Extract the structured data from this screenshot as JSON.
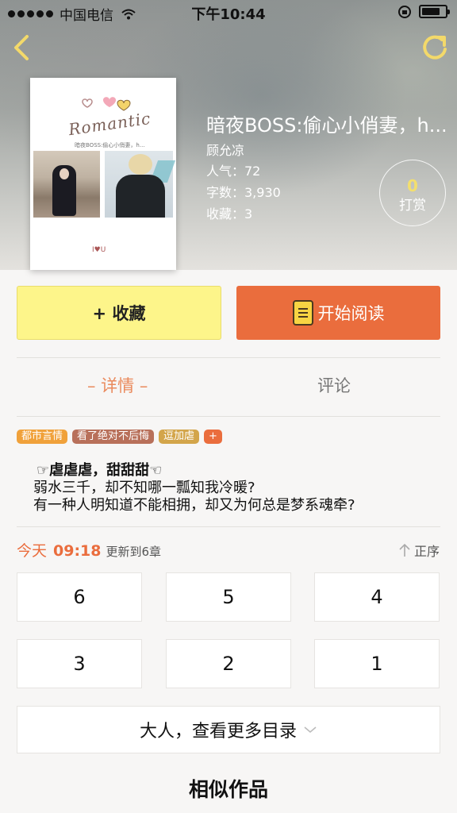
{
  "status_bar": {
    "carrier": "中国电信",
    "time": "下午10:44"
  },
  "book": {
    "title": "暗夜BOSS:偷心小俏妻，h...",
    "author": "顾允凉",
    "popularity": "人气：72",
    "word_count": "字数：3,930",
    "favorites": "收藏：3",
    "cover": {
      "title_text": "Romantic",
      "subtitle_text": "暗夜BOSS:偷心小俏妻，h...",
      "logo_text": "I♥U"
    }
  },
  "tip": {
    "count": "0",
    "label": "打赏"
  },
  "actions": {
    "favorite_label": "+ 收藏",
    "read_label": "开始阅读"
  },
  "tabs": [
    {
      "label": "– 详情 –",
      "active": true
    },
    {
      "label": "评论",
      "active": false
    }
  ],
  "tags": [
    {
      "label": "都市言情",
      "color": "#f0a13a"
    },
    {
      "label": "看了绝对不后悔",
      "color": "#b8705a"
    },
    {
      "label": "逗加虐",
      "color": "#d3a54a"
    },
    {
      "label": "+",
      "color": "#ea6d3d"
    }
  ],
  "description": {
    "line1": "☞虐虐虐，甜甜甜☜",
    "line2": "弱水三千，却不知哪一瓢知我冷暖?",
    "line3": "有一种人明知道不能相拥，却又为何总是梦系魂牵?"
  },
  "update": {
    "day": "今天",
    "time": "09:18",
    "text": "更新到6章",
    "sort_label": "正序"
  },
  "chapters": [
    "6",
    "5",
    "4",
    "3",
    "2",
    "1"
  ],
  "more_directory_label": "大人，查看更多目录",
  "similar_title": "相似作品",
  "colors": {
    "accent_orange": "#ea6d3d",
    "favorite_yellow": "#fdf58a",
    "tip_gold": "#f3df6e"
  }
}
